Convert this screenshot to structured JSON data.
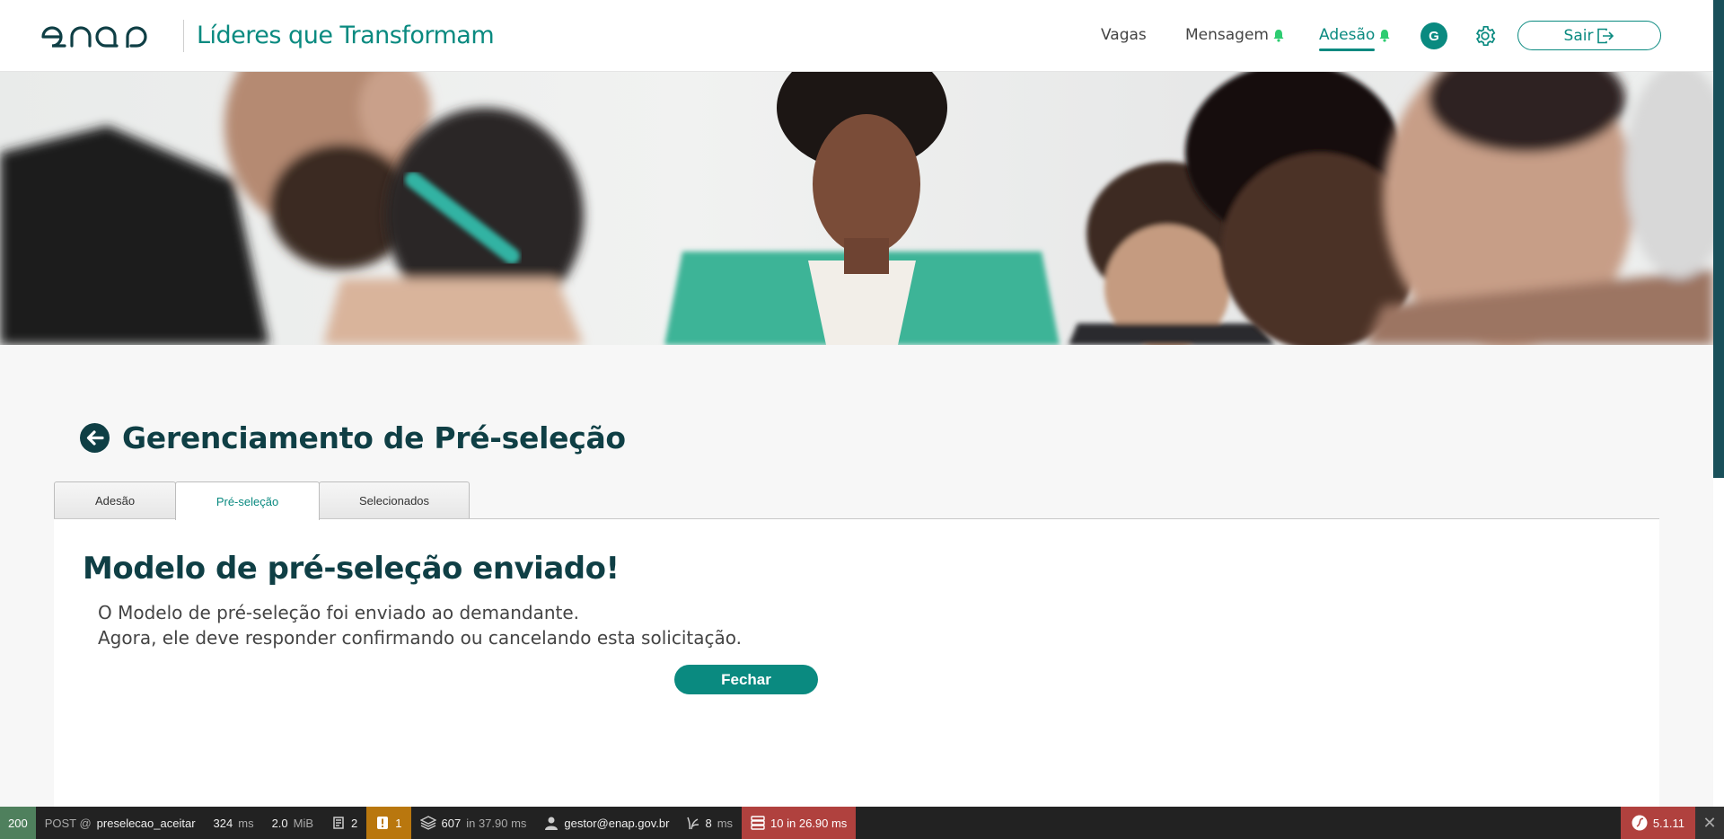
{
  "header": {
    "brand_title": "Líderes que Transformam",
    "nav": {
      "vagas": "Vagas",
      "mensagem": "Mensagem",
      "adesao": "Adesão"
    },
    "avatar_initial": "G",
    "logout_label": "Sair",
    "accent_color": "#0a8a80"
  },
  "main": {
    "page_title": "Gerenciamento de Pré-seleção",
    "tabs": [
      {
        "label": "Adesão",
        "active": false
      },
      {
        "label": "Pré-seleção",
        "active": true
      },
      {
        "label": "Selecionados",
        "active": false
      }
    ],
    "success_title": "Modelo de pré-seleção enviado!",
    "message_line1": "O Modelo de pré-seleção foi enviado ao demandante.",
    "message_line2": "Agora, ele deve responder confirmando ou cancelando esta solicitação.",
    "close_button": "Fechar"
  },
  "debug_toolbar": {
    "status_code": "200",
    "method": "POST @",
    "route": "preselecao_aceitar",
    "time_value": "324",
    "time_unit": "ms",
    "memory_value": "2.0",
    "memory_unit": "MiB",
    "forms_count": "2",
    "logs_count": "1",
    "cache_value": "607",
    "cache_suffix": "in 37.90 ms",
    "user": "gestor@enap.gov.br",
    "twig_value": "8",
    "twig_unit": "ms",
    "db_value": "10 in 26.90 ms",
    "symfony_version": "5.1.11"
  }
}
